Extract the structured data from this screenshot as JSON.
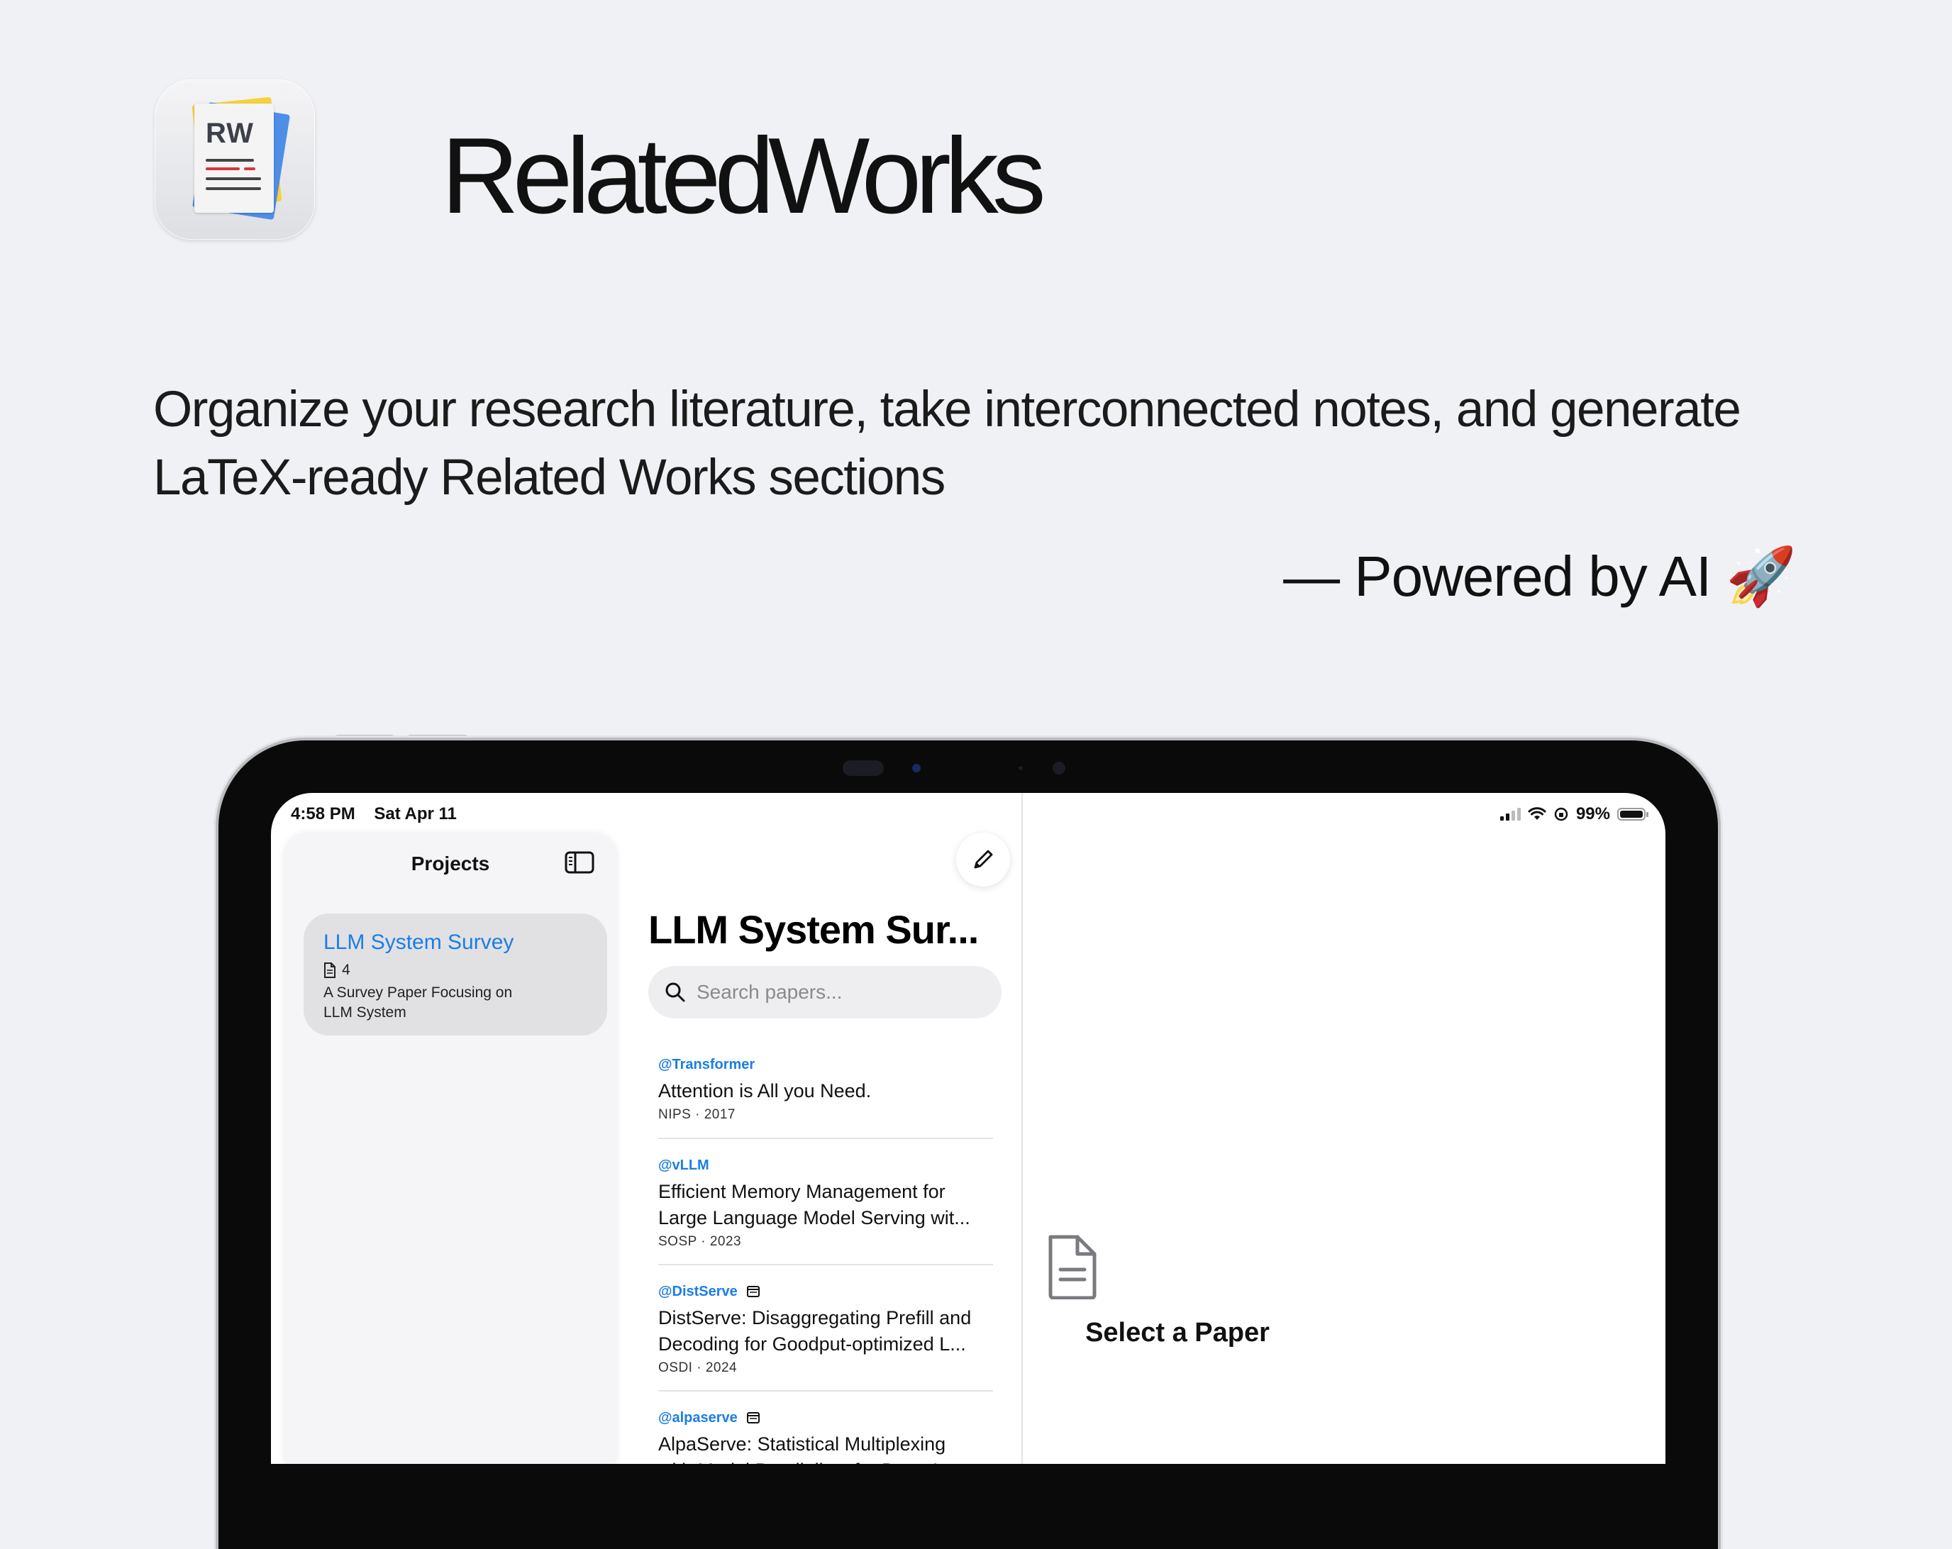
{
  "hero": {
    "app_icon_text": "RW",
    "app_name": "RelatedWorks",
    "tagline": "Organize your research literature, take interconnected notes, and generate LaTeX-ready Related Works sections",
    "powered_by": "— Powered by AI 🚀"
  },
  "status_bar": {
    "time": "4:58 PM",
    "date": "Sat Apr 11",
    "battery": "99%",
    "battery_level": 0.99
  },
  "sidebar": {
    "title": "Projects",
    "toggle_icon": "sidebar-toggle-icon",
    "projects": [
      {
        "name": "LLM System Survey",
        "paper_count": "4",
        "description": "A Survey Paper Focusing on LLM System"
      }
    ]
  },
  "paper_list": {
    "title": "LLM System Sur...",
    "compose_icon": "pencil-icon",
    "search_placeholder": "Search papers...",
    "papers": [
      {
        "key": "@Transformer",
        "title": "Attention is All you Need.",
        "venue": "NIPS · 2017",
        "has_note": false
      },
      {
        "key": "@vLLM",
        "title": "Efficient Memory Management for Large Language Model Serving wit...",
        "title_line1": "Efficient Memory Management for",
        "title_line2": "Large Language Model Serving wit...",
        "venue": "SOSP · 2023",
        "has_note": false
      },
      {
        "key": "@DistServe",
        "title_line1": "DistServe: Disaggregating Prefill and",
        "title_line2": "Decoding for Goodput-optimized L...",
        "venue": "OSDI · 2024",
        "has_note": true
      },
      {
        "key": "@alpaserve",
        "title_line1": "AlpaServe: Statistical Multiplexing",
        "title_line2": "with Model Parallelism for Deep Lea...",
        "venue": "",
        "has_note": true
      }
    ]
  },
  "detail": {
    "empty_icon": "document-icon",
    "empty_label": "Select a Paper"
  },
  "colors": {
    "accent": "#1a7ee6",
    "background": "#f0f1f4"
  }
}
